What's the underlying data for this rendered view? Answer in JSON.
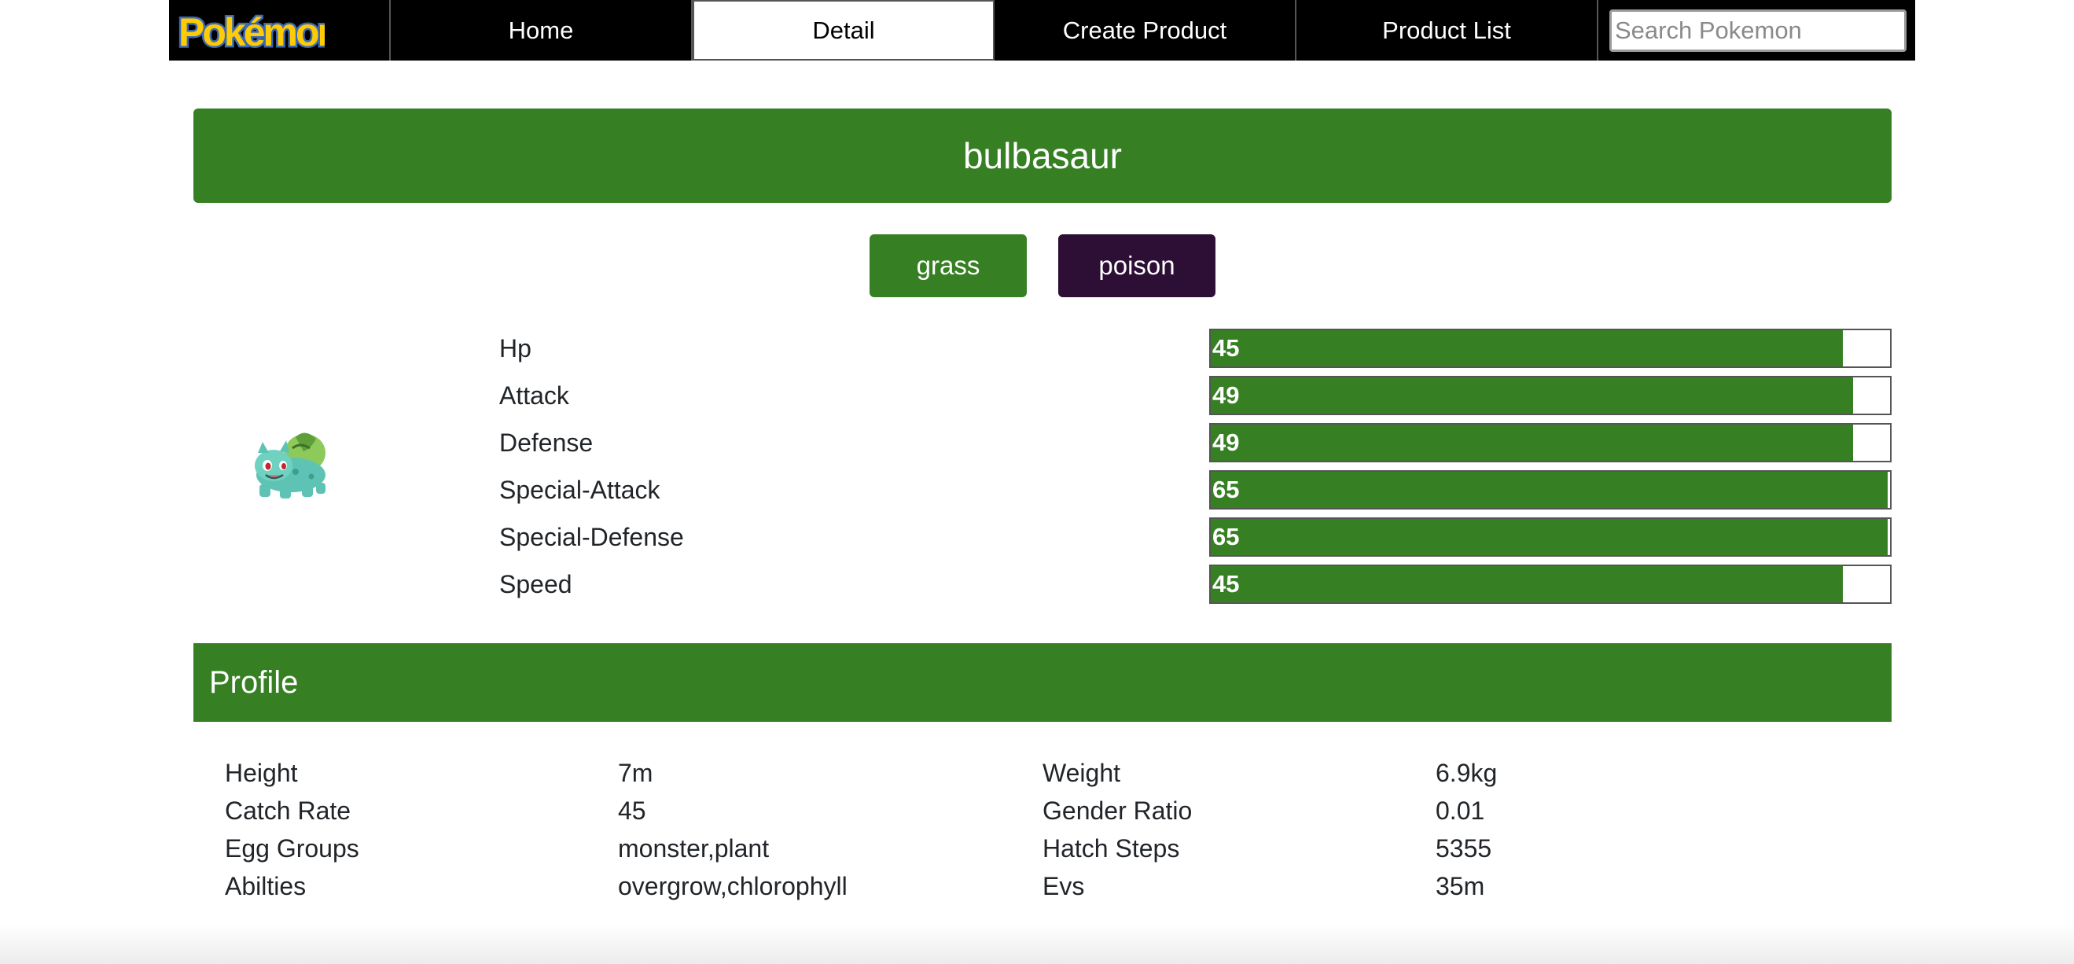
{
  "nav": {
    "logo_text": "Pokémon",
    "tabs": [
      {
        "label": "Home"
      },
      {
        "label": "Detail",
        "active": true
      },
      {
        "label": "Create Product"
      },
      {
        "label": "Product List"
      }
    ],
    "search": {
      "placeholder": "Search Pokemon",
      "value": ""
    }
  },
  "pokemon": {
    "name": "bulbasaur",
    "types": [
      {
        "label": "grass",
        "color": "#367f23"
      },
      {
        "label": "poison",
        "color": "#2d0e35"
      }
    ],
    "sprite_icon": "bulbasaur-sprite",
    "stats": [
      {
        "label": "Hp",
        "value": "45",
        "fill_percent": 93
      },
      {
        "label": "Attack",
        "value": "49",
        "fill_percent": 94.6
      },
      {
        "label": "Defense",
        "value": "49",
        "fill_percent": 94.6
      },
      {
        "label": "Special-Attack",
        "value": "65",
        "fill_percent": 99.6
      },
      {
        "label": "Special-Defense",
        "value": "65",
        "fill_percent": 99.6
      },
      {
        "label": "Speed",
        "value": "45",
        "fill_percent": 93
      }
    ]
  },
  "profile": {
    "title": "Profile",
    "rows": [
      {
        "label1": "Height",
        "value1": "7m",
        "label2": "Weight",
        "value2": "6.9kg"
      },
      {
        "label1": "Catch Rate",
        "value1": "45",
        "label2": "Gender Ratio",
        "value2": "0.01"
      },
      {
        "label1": "Egg Groups",
        "value1": "monster,plant",
        "label2": "Hatch Steps",
        "value2": "5355"
      },
      {
        "label1": "Abilties",
        "value1": "overgrow,chlorophyll",
        "label2": "Evs",
        "value2": "35m"
      }
    ]
  },
  "colors": {
    "accent_green": "#367f23",
    "poison_purple": "#2d0e35",
    "nav_black": "#000000"
  }
}
